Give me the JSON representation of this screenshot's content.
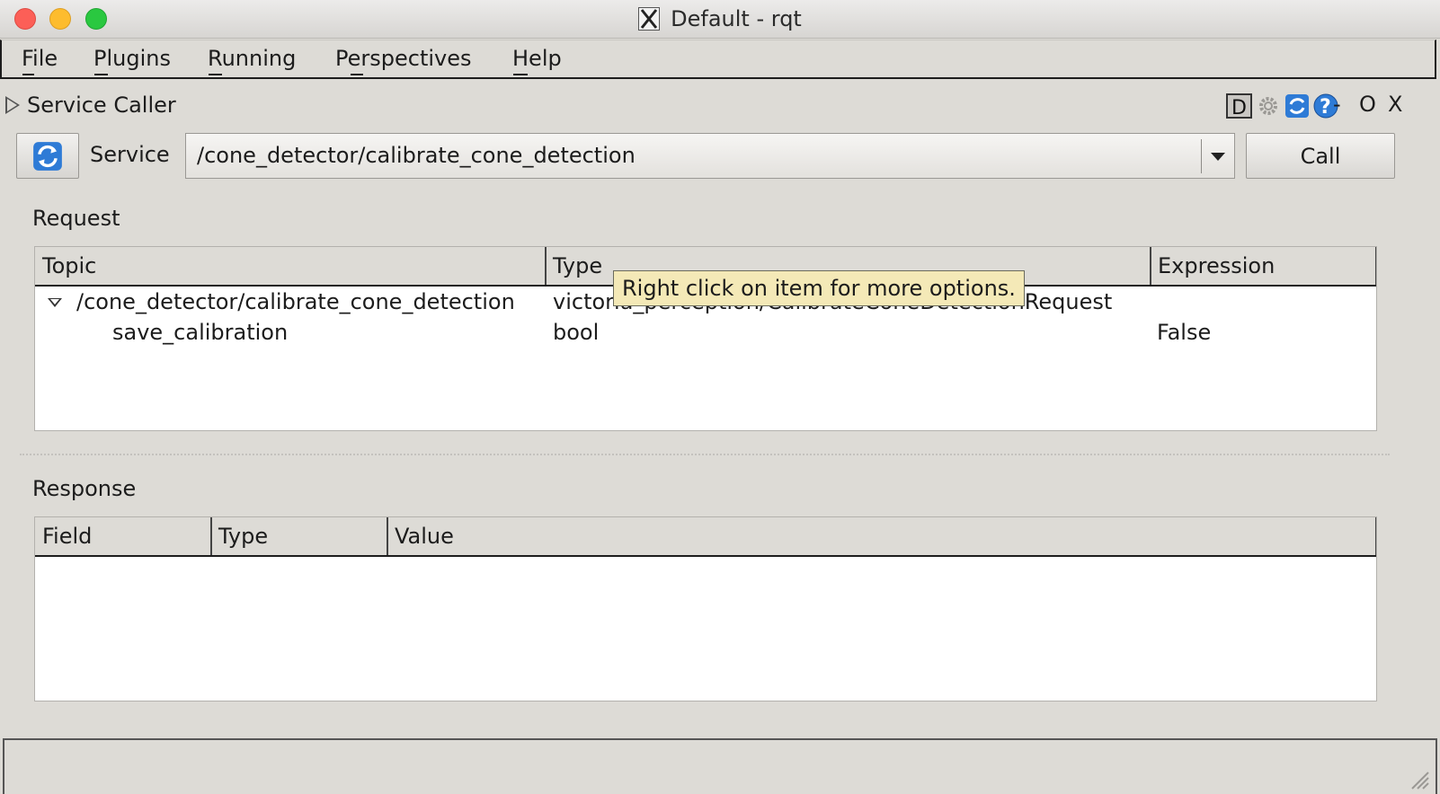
{
  "window": {
    "title": "Default - rqt"
  },
  "menu": [
    "File",
    "Plugins",
    "Running",
    "Perspectives",
    "Help"
  ],
  "plugin": {
    "title": "Service Caller",
    "controls": [
      "-",
      "O",
      "X"
    ]
  },
  "service": {
    "label": "Service",
    "selected": "/cone_detector/calibrate_cone_detection",
    "call_label": "Call"
  },
  "request": {
    "label": "Request",
    "columns": [
      "Topic",
      "Type",
      "Expression"
    ],
    "rows": [
      {
        "topic": "/cone_detector/calibrate_cone_detection",
        "type": "victoria_perception/CalibrateConeDetectionRequest",
        "expression": ""
      },
      {
        "topic": "save_calibration",
        "type": "bool",
        "expression": "False"
      }
    ]
  },
  "tooltip": "Right click on item for more options.",
  "response": {
    "label": "Response",
    "columns": [
      "Field",
      "Type",
      "Value"
    ]
  },
  "colors": {
    "accent": "#2e7bd6",
    "tooltip_bg": "#f4e9b7"
  }
}
